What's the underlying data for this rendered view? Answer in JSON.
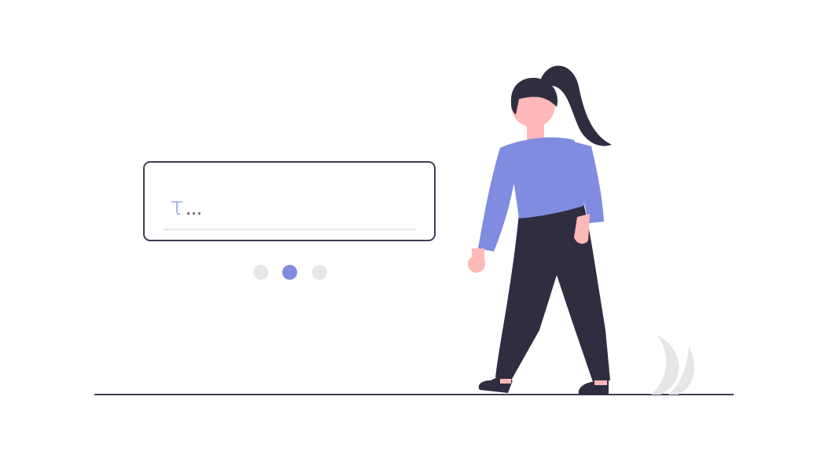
{
  "input_card": {
    "typed_char": "τ",
    "ellipsis": "..."
  },
  "pagination": {
    "count": 3,
    "active_index": 1
  },
  "colors": {
    "accent": "#7f8ce0",
    "dark": "#3f3d56",
    "pants": "#2f2e41",
    "skin": "#ffb8b8",
    "light": "#e6e6e6"
  }
}
